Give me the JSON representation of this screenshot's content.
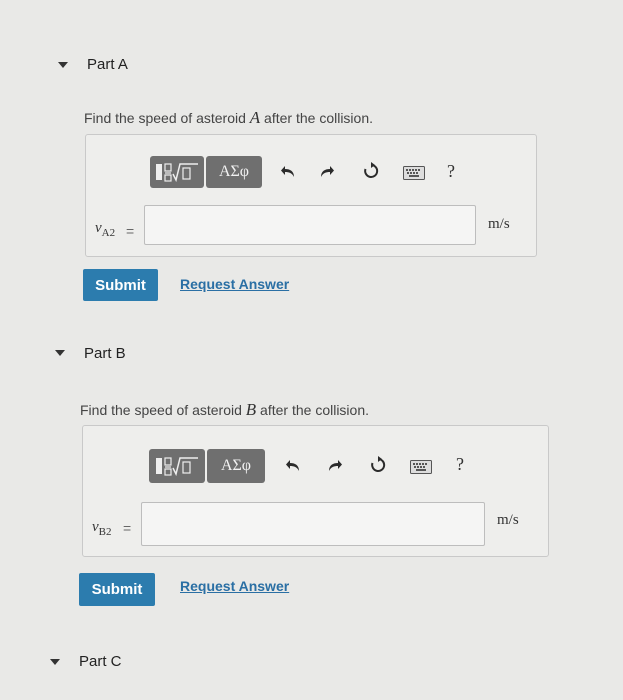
{
  "parts": [
    {
      "title": "Part A",
      "question_prefix": "Find the speed of asteroid ",
      "question_var": "A",
      "question_suffix": " after the collision.",
      "var_main": "v",
      "var_sub": "A2",
      "equals": "=",
      "unit": "m/s",
      "toolbar": {
        "greek_label": "ΑΣφ",
        "help_label": "?"
      },
      "input_value": "",
      "submit_label": "Submit",
      "request_label": "Request Answer"
    },
    {
      "title": "Part B",
      "question_prefix": "Find the speed of asteroid ",
      "question_var": "B",
      "question_suffix": " after the collision.",
      "var_main": "v",
      "var_sub": "B2",
      "equals": "=",
      "unit": "m/s",
      "toolbar": {
        "greek_label": "ΑΣφ",
        "help_label": "?"
      },
      "input_value": "",
      "submit_label": "Submit",
      "request_label": "Request Answer"
    },
    {
      "title": "Part C"
    }
  ],
  "icons": {
    "collapse": "caret-down-icon",
    "templates": "templates-icon",
    "undo": "undo-icon",
    "redo": "redo-icon",
    "reset": "reset-icon",
    "keyboard": "keyboard-icon"
  },
  "colors": {
    "submit": "#2c7cae",
    "link": "#2a6fa4",
    "toolbar_button": "#6f6f6f"
  }
}
